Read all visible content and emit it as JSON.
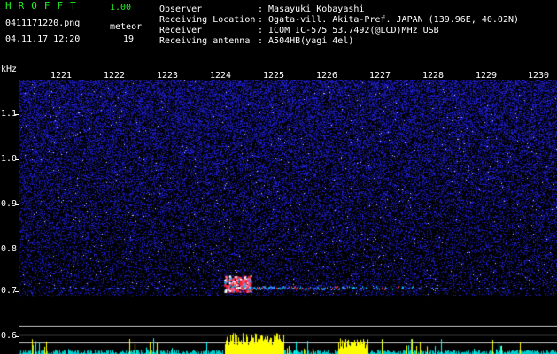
{
  "app": {
    "logo_text": "HROFFT",
    "version": "1.00",
    "filename": "0411171220.png",
    "datetime": "04.11.17 12:20",
    "meteor_label": "meteor",
    "meteor_count": "19"
  },
  "info": {
    "observer_label": "Observer",
    "observer_value": ": Masayuki Kobayashi",
    "location_label": "Receiving Location",
    "location_value": ": Ogata-vill. Akita-Pref. JAPAN (139.96E, 40.02N)",
    "receiver_label": "Receiver",
    "receiver_value": ": ICOM IC-575 53.7492(@LCD)MHz USB",
    "antenna_label": "Receiving antenna",
    "antenna_value": ": A504HB(yagi 4el)"
  },
  "axis": {
    "unit": "kHz",
    "time_ticks": [
      "1221",
      "1222",
      "1223",
      "1224",
      "1225",
      "1226",
      "1227",
      "1228",
      "1229",
      "1230"
    ],
    "freq_ticks": [
      "1.1",
      "1.0",
      "0.9",
      "0.8",
      "0.7",
      "0.6"
    ]
  },
  "colors": {
    "background": "#000000",
    "noise": "#1a1a8c",
    "signal_hot": "#ff2020",
    "signal_mid": "#00ccff",
    "bar_yellow": "#ffff00",
    "bar_cyan": "#00ffff",
    "header_green": "#22ee22"
  }
}
